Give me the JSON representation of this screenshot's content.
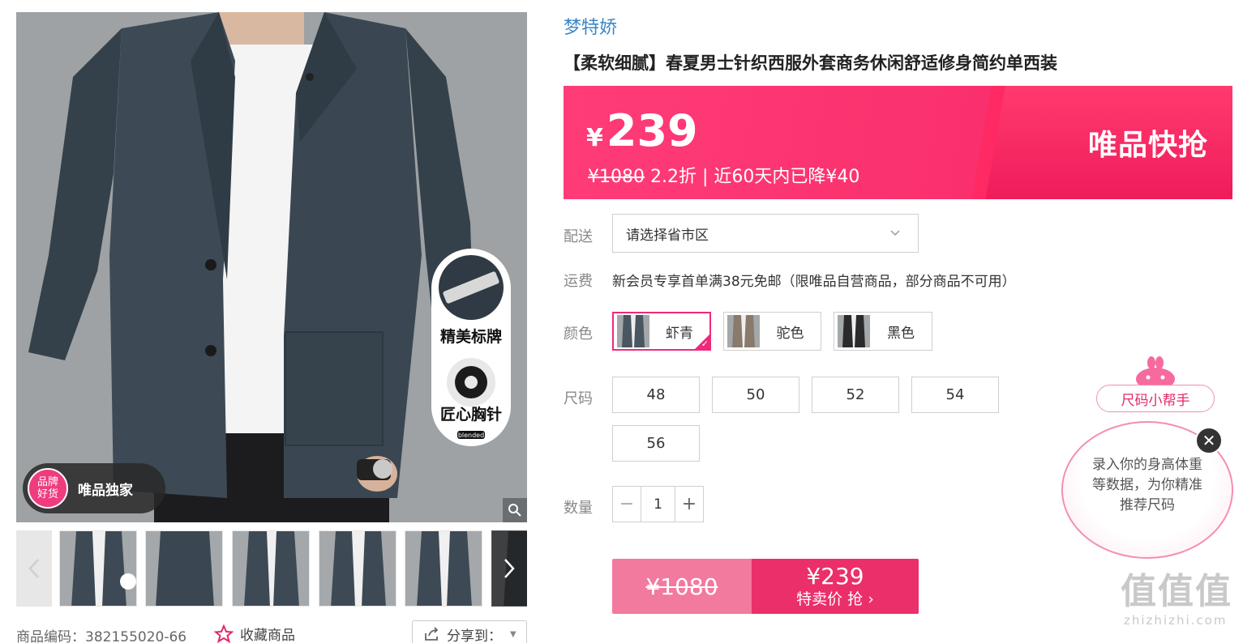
{
  "gallery": {
    "exclusive_badge_circle_line1": "品牌",
    "exclusive_badge_circle_line2": "好货",
    "exclusive_badge_text": "唯品独家",
    "feature_1": "精美标牌",
    "feature_2": "匠心胸针",
    "feature_2_small": "blended",
    "icons": [
      "zoom-icon",
      "chevron-left-icon",
      "chevron-right-icon"
    ],
    "thumbnail_count": 6
  },
  "footer": {
    "sku_code": "商品编码：382155020-66",
    "favorite": "收藏商品",
    "share": "分享到："
  },
  "product": {
    "brand": "梦特娇",
    "title": "【柔软细腻】春夏男士针织西服外套商务休闲舒适修身简约单西装"
  },
  "price": {
    "currency": "¥",
    "current": "239",
    "original": "¥1080",
    "discount": "2.2折",
    "separator": "|",
    "drop_note": "近60天内已降¥40",
    "flash_label": "唯品快抢",
    "banner_color": "#f9306d"
  },
  "delivery": {
    "label": "配送",
    "placeholder": "请选择省市区"
  },
  "shipping": {
    "label": "运费",
    "text": "新会员专享首单满38元免邮（限唯品自营商品，部分商品不可用）"
  },
  "colors": {
    "label": "颜色",
    "options": [
      {
        "name": "虾青",
        "selected": true,
        "swatch": "#4a5660"
      },
      {
        "name": "驼色",
        "selected": false,
        "swatch": "#8a7a6c"
      },
      {
        "name": "黑色",
        "selected": false,
        "swatch": "#2a2a2c"
      }
    ]
  },
  "sizes": {
    "label": "尺码",
    "options": [
      "48",
      "50",
      "52",
      "54",
      "56"
    ]
  },
  "quantity": {
    "label": "数量",
    "value": "1",
    "minus": "−",
    "plus": "+"
  },
  "buy": {
    "original_price": "¥1080",
    "price": "¥239",
    "action": "特卖价 抢"
  },
  "size_helper": {
    "tag": "尺码小帮手",
    "text": "录入你的身高体重等数据，为你精准推荐尺码",
    "close": "✕"
  },
  "watermark": {
    "big": "值值值",
    "small": "zhizhizhi.com"
  }
}
